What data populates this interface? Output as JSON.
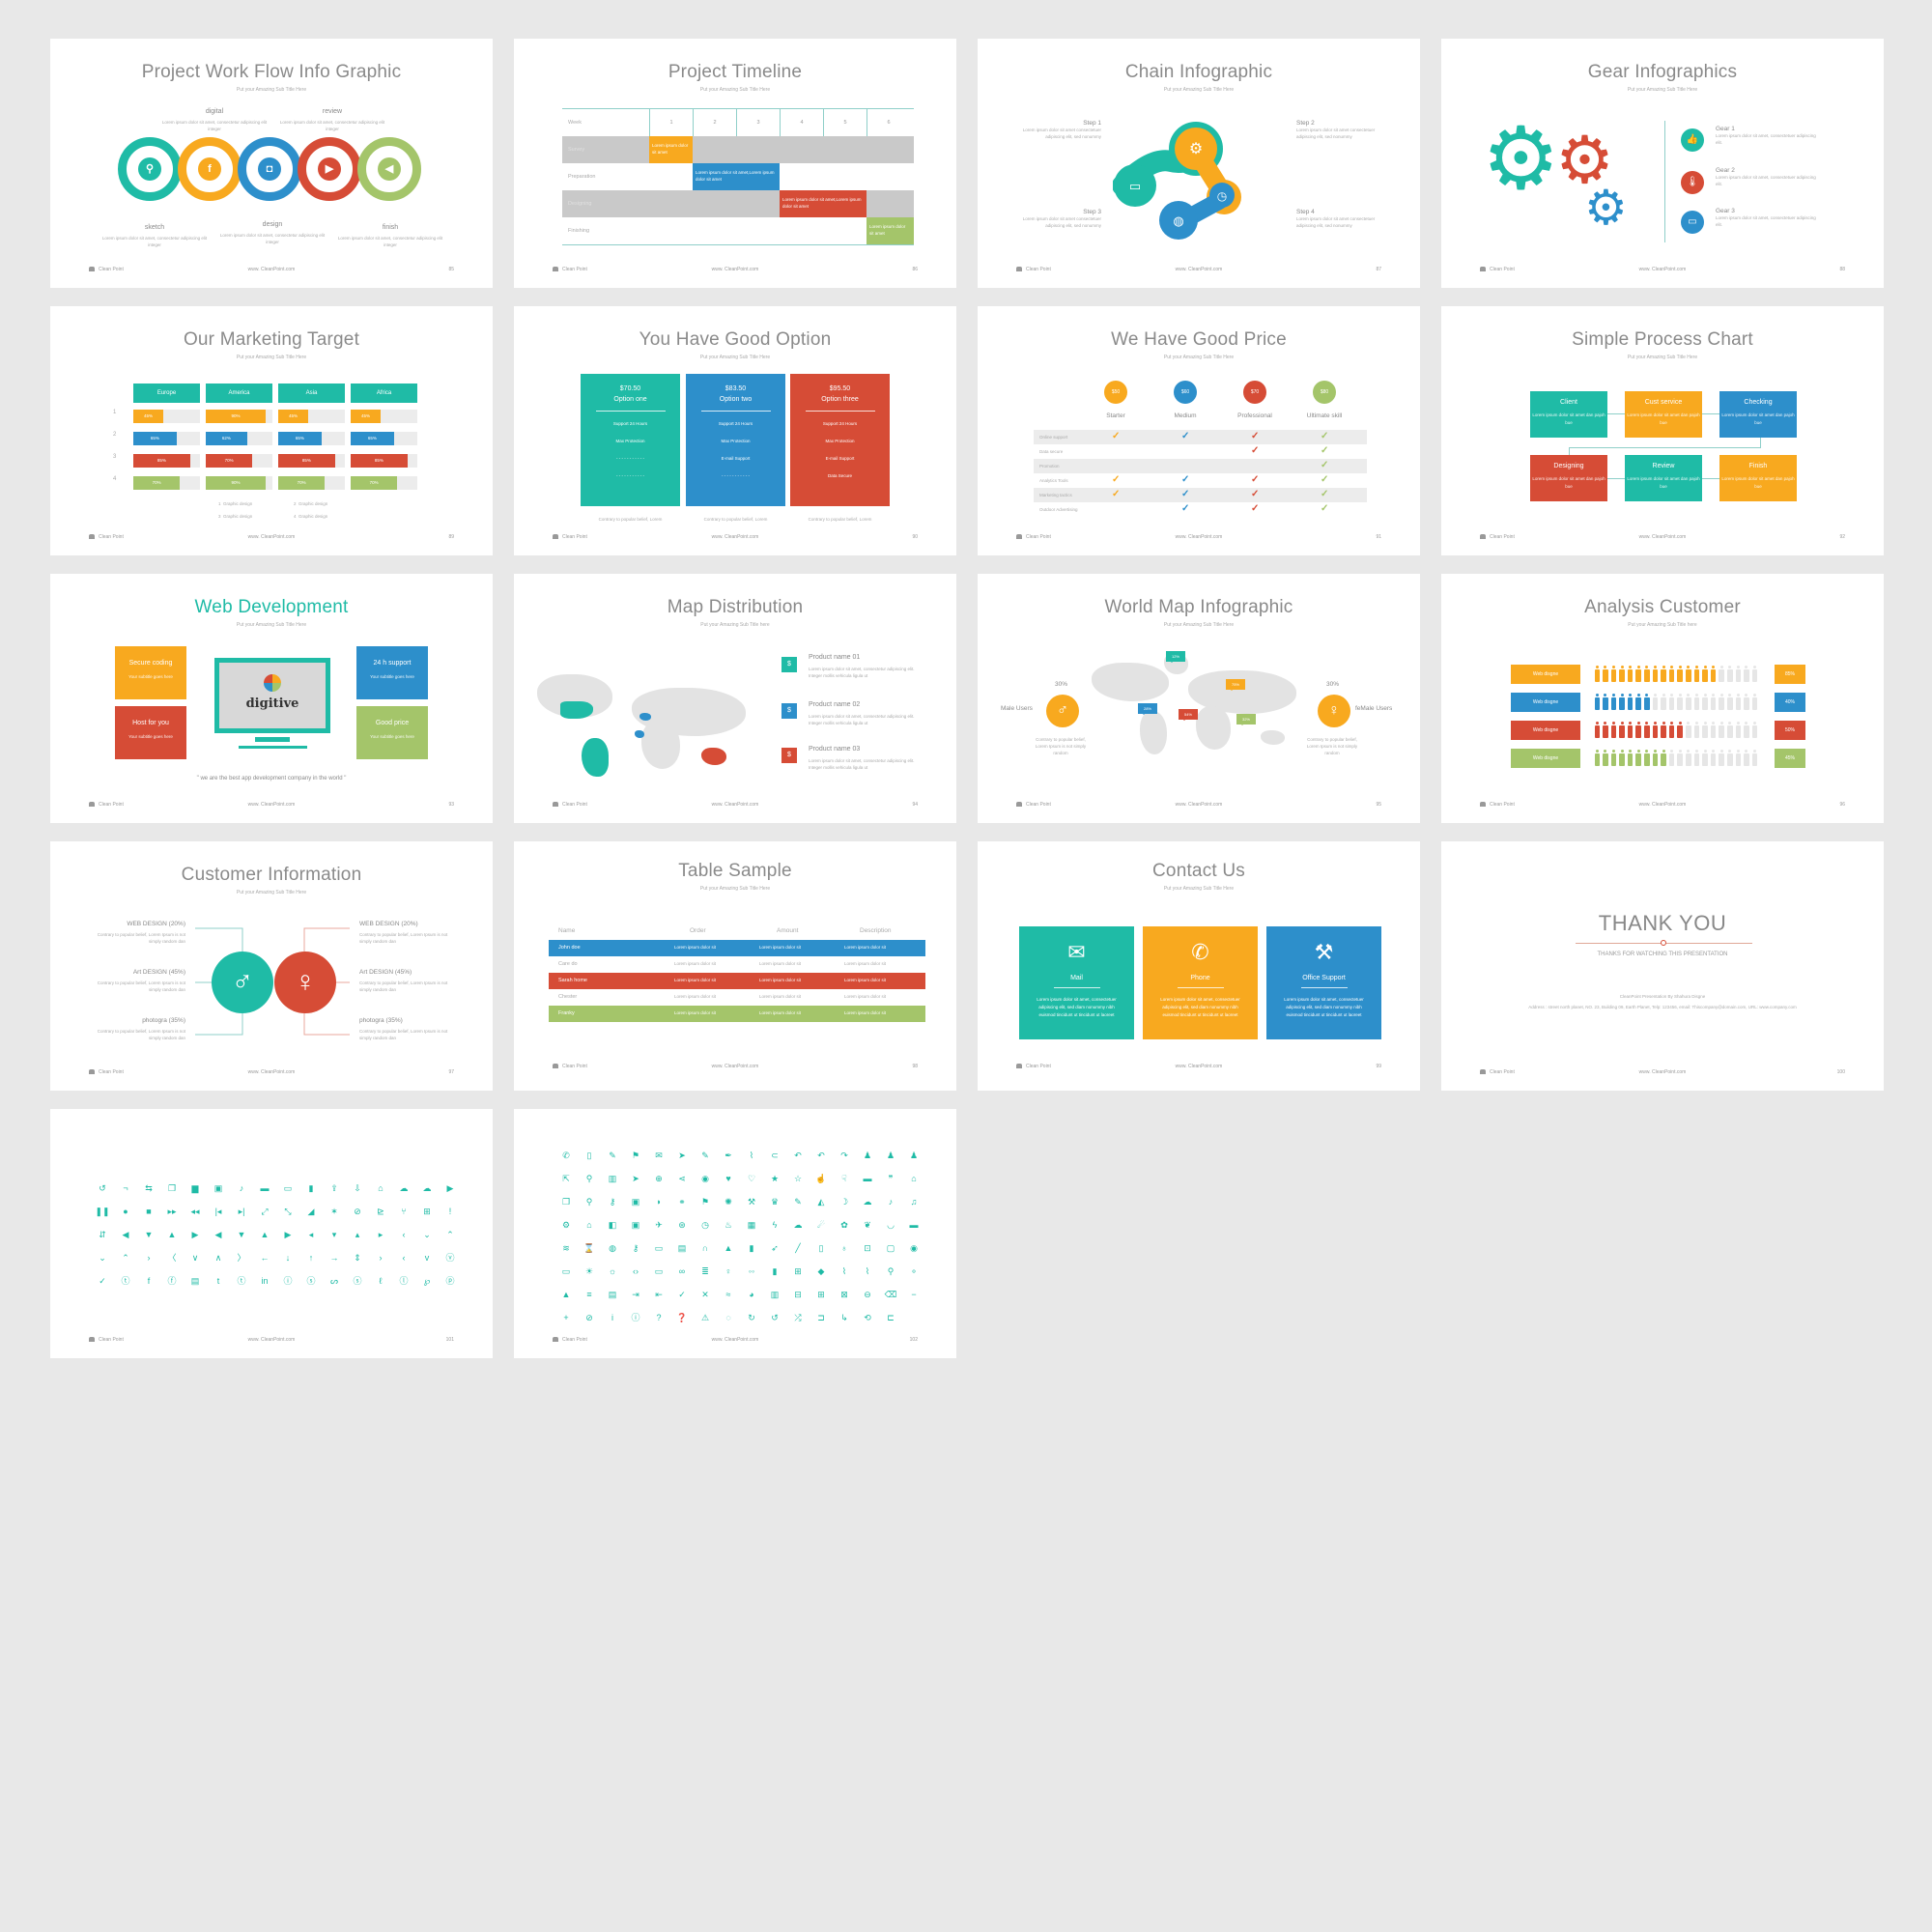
{
  "common": {
    "subtitle": "Put your Amazing Sub Title Here",
    "brand": "Clean Point",
    "url": "www. CleanPoint.com",
    "lorem_short": "Lorem ipsum dolor sit amet, consectetur adipiscing elit integer",
    "colors": {
      "teal": "#1fbba6",
      "orange": "#f8a91f",
      "blue": "#2d8fcb",
      "red": "#d64c36",
      "green": "#a4c56a",
      "background": "#e8e8e8"
    }
  },
  "slides": {
    "workflow": {
      "title": "Project Work Flow Info Graphic",
      "page": "85",
      "steps": [
        {
          "label": "sketch",
          "icon": "search-icon",
          "glyph": "⚲"
        },
        {
          "label": "digital",
          "icon": "facebook-icon",
          "glyph": "f"
        },
        {
          "label": "design",
          "icon": "camera-icon",
          "glyph": "◘"
        },
        {
          "label": "review",
          "icon": "video-icon",
          "glyph": "▶"
        },
        {
          "label": "finish",
          "icon": "megaphone-icon",
          "glyph": "◀"
        }
      ]
    },
    "timeline": {
      "title": "Project Timeline",
      "page": "86",
      "week_label": "Week",
      "weeks": [
        "1",
        "2",
        "3",
        "4",
        "5",
        "6"
      ],
      "rows": [
        {
          "label": "Survey",
          "start": 1,
          "span": 1,
          "text": "Lorem ipsum dolor sit amet"
        },
        {
          "label": "Preparation",
          "start": 2,
          "span": 2,
          "text": "Lorem ipsum dolor sit amet,Lorem ipsum dolor sit amet"
        },
        {
          "label": "Designing",
          "start": 4,
          "span": 2,
          "text": "Lorem ipsum dolor sit amet,Lorem ipsum dolor sit amet"
        },
        {
          "label": "Finishing",
          "start": 6,
          "span": 1,
          "text": "Lorem ipsum dolor sit amet"
        }
      ]
    },
    "chain": {
      "title": "Chain Infographic",
      "page": "87",
      "steps": [
        {
          "label": "Step 1",
          "text": "Lorem ipsum dolor sit amet consectetuer adipiscing elit, sed nonummy"
        },
        {
          "label": "Step 2",
          "text": "Lorem ipsum dolor sit amet consectetuer adipiscing elit, sed nonummy"
        },
        {
          "label": "Step 3",
          "text": "Lorem ipsum dolor sit amet consectetuer adipiscing elit, sed nonummy"
        },
        {
          "label": "Step 4",
          "text": "Lorem ipsum dolor sit amet consectetuer adipiscing elit, sed nonummy"
        }
      ]
    },
    "gear": {
      "title": "Gear Infographics",
      "page": "88",
      "items": [
        {
          "label": "Gear 1",
          "text": "Lorem ipsum dolor sit amet, consectetuer adipiscing elit."
        },
        {
          "label": "Gear 2",
          "text": "Lorem ipsum dolor sit amet, consectetuer adipiscing elit."
        },
        {
          "label": "Gear 3",
          "text": "Lorem ipsum dolor sit amet, consectetuer adipiscing elit."
        }
      ]
    },
    "marketing": {
      "title": "Our Marketing Target",
      "page": "89",
      "regions": [
        "Europe",
        "America",
        "Asia",
        "Africa"
      ],
      "row_labels": [
        "1",
        "2",
        "3",
        "4"
      ],
      "values": [
        [
          45,
          90,
          45,
          45
        ],
        [
          65,
          62,
          65,
          65
        ],
        [
          85,
          70,
          85,
          85
        ],
        [
          70,
          90,
          70,
          70
        ]
      ],
      "legend": [
        "Graphic design",
        "Graphic design",
        "Graphic design",
        "Graphic design"
      ]
    },
    "options": {
      "title": "You Have Good Option",
      "page": "90",
      "cards": [
        {
          "price": "$70.50",
          "name": "Option one",
          "features": [
            "Support 24 Hours",
            "Max Protection",
            "- - - - - - - - - - -",
            "- - - - - - - - - - -"
          ],
          "note": "Contrary to popular belief, Lorem"
        },
        {
          "price": "$83.50",
          "name": "Option two",
          "features": [
            "Support 24 Hours",
            "Max Protection",
            "E-mail Support",
            "- - - - - - - - - - -"
          ],
          "note": "Contrary to popular belief, Lorem"
        },
        {
          "price": "$95.50",
          "name": "Option three",
          "features": [
            "Support 24 Hours",
            "Max Protection",
            "E-mail Support",
            "Data Secure"
          ],
          "note": "Contrary to popular belief, Lorem"
        }
      ]
    },
    "price": {
      "title": "We Have Good Price",
      "page": "91",
      "plans": [
        {
          "price": "$50",
          "name": "Starter"
        },
        {
          "price": "$60",
          "name": "Medium"
        },
        {
          "price": "$70",
          "name": "Professional"
        },
        {
          "price": "$80",
          "name": "Ultimate skill"
        }
      ],
      "features": [
        {
          "label": "Online support",
          "checks": [
            true,
            true,
            true,
            true
          ]
        },
        {
          "label": "Data secure",
          "checks": [
            false,
            false,
            true,
            true
          ]
        },
        {
          "label": "Promotion",
          "checks": [
            false,
            false,
            false,
            true
          ]
        },
        {
          "label": "Analytics Tools",
          "checks": [
            true,
            true,
            true,
            true
          ]
        },
        {
          "label": "Marketing tactics",
          "checks": [
            true,
            true,
            true,
            true
          ]
        },
        {
          "label": "Outdoor Advertising",
          "checks": [
            false,
            true,
            true,
            true
          ]
        }
      ],
      "check_glyph": "✓"
    },
    "process": {
      "title": "Simple Process Chart",
      "page": "92",
      "boxes": [
        {
          "label": "Client",
          "text": "Lorem ipsum dolor sit amet dan pajoh bue"
        },
        {
          "label": "Cust service",
          "text": "Lorem ipsum dolor sit amet dan pajoh bue"
        },
        {
          "label": "Checking",
          "text": "Lorem ipsum dolor sit amet dan pajoh bue"
        },
        {
          "label": "Designing",
          "text": "Lorem ipsum dolor sit amet dan pajoh bue"
        },
        {
          "label": "Review",
          "text": "Lorem ipsum dolor sit amet dan pajoh bue"
        },
        {
          "label": "Finish",
          "text": "Lorem ipsum dolor sit amet dan pajoh bue"
        }
      ]
    },
    "webdev": {
      "title": "Web Development",
      "page": "93",
      "boxes": [
        {
          "label": "Secure coding",
          "text": "Your subtitle goes here"
        },
        {
          "label": "Host for you",
          "text": "Your subtitle goes here"
        },
        {
          "label": "24 h support",
          "text": "Your subtitle goes here"
        },
        {
          "label": "Good price",
          "text": "Your subtitle goes here"
        }
      ],
      "screen_logo": "digitive",
      "quote": "\" we are the best app development company in the world \""
    },
    "mapdist": {
      "title": "Map Distribution",
      "subtitle": "Put your Amazing Sub Title here",
      "page": "94",
      "products": [
        {
          "name": "Product name 01",
          "text": "Lorem ipsum dolor sit amet, consectetur adipiscing elit. Integer mollis vehicula ligula ut"
        },
        {
          "name": "Product name 02",
          "text": "Lorem ipsum dolor sit amet, consectetur adipiscing elit. Integer mollis vehicula ligula ut"
        },
        {
          "name": "Product name 03",
          "text": "Lorem ipsum dolor sit amet, consectetur adipiscing elit. Integer mollis vehicula ligula ut"
        }
      ]
    },
    "worldmap": {
      "title": "World Map Infographic",
      "page": "95",
      "male": {
        "pct": "30%",
        "label": "Male Users",
        "text": "Contrary to popular belief, Lorem Ipsum is not simply random"
      },
      "female": {
        "pct": "30%",
        "label": "feMale Users",
        "text": "Contrary to popular belief, Lorem Ipsum is not simply random"
      },
      "tags": [
        "12%",
        "28%",
        "54%",
        "75%",
        "32%"
      ]
    },
    "analysis": {
      "title": "Analysis Customer",
      "subtitle": "Put your Amazing Sub Title here",
      "page": "96",
      "rows": [
        {
          "label": "Web disgne",
          "pct": "85%",
          "filled": 15
        },
        {
          "label": "Web disgne",
          "pct": "40%",
          "filled": 7
        },
        {
          "label": "Web disgne",
          "pct": "50%",
          "filled": 11
        },
        {
          "label": "Web disgne",
          "pct": "45%",
          "filled": 9
        }
      ],
      "total_icons": 20
    },
    "custinfo": {
      "title": "Customer Information",
      "page": "97",
      "left": [
        {
          "label": "WEB DESIGN (20%)",
          "text": "Contrary to popular belief, Lorem Ipsum is not simply random dan"
        },
        {
          "label": "Art DESIGN (45%)",
          "text": "Contrary to popular belief, Lorem Ipsum is not simply random dan"
        },
        {
          "label": "photogra (35%)",
          "text": "Contrary to popular belief, Lorem Ipsum is not simply random dan"
        }
      ],
      "right": [
        {
          "label": "WEB DESIGN (20%)",
          "text": "Contrary to popular belief, Lorem Ipsum is not simply random dan"
        },
        {
          "label": "Art DESIGN (45%)",
          "text": "Contrary to popular belief, Lorem Ipsum is not simply random dan"
        },
        {
          "label": "photogra (35%)",
          "text": "Contrary to popular belief, Lorem Ipsum is not simply random dan"
        }
      ]
    },
    "table": {
      "title": "Table Sample",
      "page": "98",
      "headers": [
        "Name",
        "Order",
        "Amount",
        "Description"
      ],
      "rows": [
        {
          "name": "John doe",
          "cells": [
            "Lorem ipsum dolor sit",
            "Lorem ipsum dolor sit",
            "Lorem ipsum dolor sit"
          ]
        },
        {
          "name": "Care do",
          "cells": [
            "Lorem ipsum dolor sit",
            "Lorem ipsum dolor sit",
            "Lorem ipsum dolor sit"
          ]
        },
        {
          "name": "Sarah home",
          "cells": [
            "Lorem ipsum dolor sit",
            "Lorem ipsum dolor sit",
            "Lorem ipsum dolor sit"
          ]
        },
        {
          "name": "Chester",
          "cells": [
            "Lorem ipsum dolor sit",
            "Lorem ipsum dolor sit",
            "Lorem ipsum dolor sit"
          ]
        },
        {
          "name": "Franky",
          "cells": [
            "Lorem ipsum dolor sit",
            "Lorem ipsum dolor sit",
            "Lorem ipsum dolor sit"
          ]
        }
      ]
    },
    "contact": {
      "title": "Contact Us",
      "page": "99",
      "cards": [
        {
          "label": "Mail",
          "glyph": "✉",
          "text": "Lorem ipsum dolor sit amet, consectetuer adipiscing elit, sed diam nonummy nibh euismod tincidunt ut tincidunt ut laoreet"
        },
        {
          "label": "Phone",
          "glyph": "✆",
          "text": "Lorem ipsum dolor sit amet, consectetuer adipiscing elit, sed diam nonummy nibh euismod tincidunt ut tincidunt ut laoreet"
        },
        {
          "label": "Office Support",
          "glyph": "⚒",
          "text": "Lorem ipsum dolor sit amet, consectetuer adipiscing elit, sed diam nonummy nibh euismod tincidunt ut tincidunt ut laoreet"
        }
      ]
    },
    "thanks": {
      "title": "THANK YOU",
      "page": "100",
      "subtitle": "THANKS FOR WATCHING THIS PRESENTATION",
      "credit": "CleanPoint Presentation By Shahura Disgne",
      "address": "Address : street north planet, NO. 23, Building 09, Earth Planet, Telp: 123456, email: Thiscompany@domain.com, URL: www.company.com"
    },
    "icons1": {
      "page": "101",
      "glyphs": [
        "↺",
        "¬",
        "⇆",
        "❐",
        "▆",
        "▣",
        "♪",
        "▬",
        "▭",
        "▮",
        "⇪",
        "⇩",
        "⌂",
        "☁",
        "☁",
        "▶",
        "❚❚",
        "●",
        "■",
        "▸▸",
        "◂◂",
        "|◂",
        "▸|",
        "⤢",
        "⤡",
        "◢",
        "✶",
        "⊘",
        "⊵",
        "⑂",
        "⊞",
        "!",
        "⇵",
        "◀",
        "▼",
        "▲",
        "▶",
        "◀",
        "▼",
        "▲",
        "▶",
        "◂",
        "▾",
        "▴",
        "▸",
        "‹",
        "⌄",
        "⌃",
        "⌄",
        "⌃",
        "›",
        "〈",
        "∨",
        "∧",
        "〉",
        "←",
        "↓",
        "↑",
        "→",
        "⇕",
        "›",
        "‹",
        "v",
        "ⓥ",
        "✓",
        "ⓣ",
        "f",
        "ⓕ",
        "▤",
        "t",
        "ⓣ",
        "in",
        "ⓘ",
        "ⓢ",
        "ᔕ",
        "ⓢ",
        "ℓ",
        "ⓛ",
        "℘",
        "ⓟ"
      ]
    },
    "icons2": {
      "page": "102",
      "glyphs": [
        "✆",
        "▯",
        "✎",
        "⚑",
        "✉",
        "➤",
        "✎",
        "✒",
        "⌇",
        "⊂",
        "↶",
        "↶",
        "↷",
        "♟",
        "♟",
        "♟",
        "⇱",
        "⚲",
        "▥",
        "➤",
        "⊕",
        "⋖",
        "◉",
        "♥",
        "♡",
        "★",
        "☆",
        "☝",
        "☟",
        "▬",
        "❞",
        "⌂",
        "❐",
        "⚲",
        "⚷",
        "▣",
        "◗",
        "⚭",
        "⚑",
        "✺",
        "⚒",
        "♛",
        "✎",
        "◭",
        "☽",
        "☁",
        "♪",
        "♫",
        "⚙",
        "⌂",
        "◧",
        "▣",
        "✈",
        "⊛",
        "◷",
        "♨",
        "▦",
        "ϟ",
        "☁",
        "☄",
        "✿",
        "❦",
        "◡",
        "▬",
        "≋",
        "⌛",
        "◍",
        "⚷",
        "▭",
        "▤",
        "∩",
        "▲",
        "▮",
        "➶",
        "╱",
        "▯",
        "♁",
        "⊡",
        "▢",
        "◉",
        "▭",
        "☀",
        "☼",
        "‹›",
        "▭",
        "∞",
        "≣",
        "♀",
        "◦◦",
        "▮",
        "⊞",
        "◆",
        "⌇",
        "⌇",
        "⚲",
        "⚬",
        "▲",
        "≡",
        "▤",
        "⇥",
        "⇤",
        "✓",
        "✕",
        "≈",
        "◕",
        "▥",
        "⊟",
        "⊞",
        "⊠",
        "⊖",
        "⌫",
        "−",
        "+",
        "⊘",
        "i",
        "ⓘ",
        "?",
        "❓",
        "⚠",
        "◌",
        "↻",
        "↺",
        "⤮",
        "⊐",
        "↳",
        "⟲",
        "⊏"
      ]
    }
  }
}
